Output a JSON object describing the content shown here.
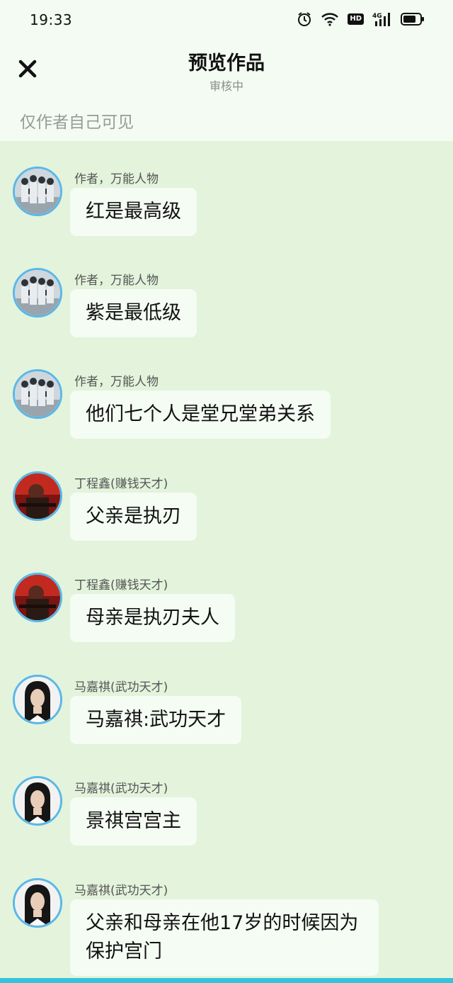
{
  "status_bar": {
    "time": "19:33",
    "icons": [
      "alarm-icon",
      "wifi-icon",
      "hd-badge",
      "signal-4g-icon",
      "battery-icon"
    ],
    "hd_label": "HD",
    "network_label": "4G"
  },
  "header": {
    "title": "预览作品",
    "subtitle": "审核中",
    "visibility_note": "仅作者自己可见"
  },
  "colors": {
    "background": "#e3f3dc",
    "header_background": "#f3fbf2",
    "bubble": "#f4fcf3",
    "avatar_ring": "#59b8e8",
    "bottom_accent": "#36c3d9"
  },
  "messages": [
    {
      "sender": "作者，万能人物",
      "text": "红是最高级",
      "avatar": "group-photo"
    },
    {
      "sender": "作者，万能人物",
      "text": "紫是最低级",
      "avatar": "group-photo"
    },
    {
      "sender": "作者，万能人物",
      "text": "他们七个人是堂兄堂弟关系",
      "avatar": "group-photo"
    },
    {
      "sender": "丁程鑫(赚钱天才)",
      "text": "父亲是执刃",
      "avatar": "red-portrait"
    },
    {
      "sender": "丁程鑫(赚钱天才)",
      "text": "母亲是执刃夫人",
      "avatar": "red-portrait"
    },
    {
      "sender": "马嘉祺(武功天才)",
      "text": "马嘉祺:武功天才",
      "avatar": "portrait"
    },
    {
      "sender": "马嘉祺(武功天才)",
      "text": "景祺宫宫主",
      "avatar": "portrait"
    },
    {
      "sender": "马嘉祺(武功天才)",
      "text": "父亲和母亲在他17岁的时候因为保护宫门",
      "avatar": "portrait"
    }
  ]
}
